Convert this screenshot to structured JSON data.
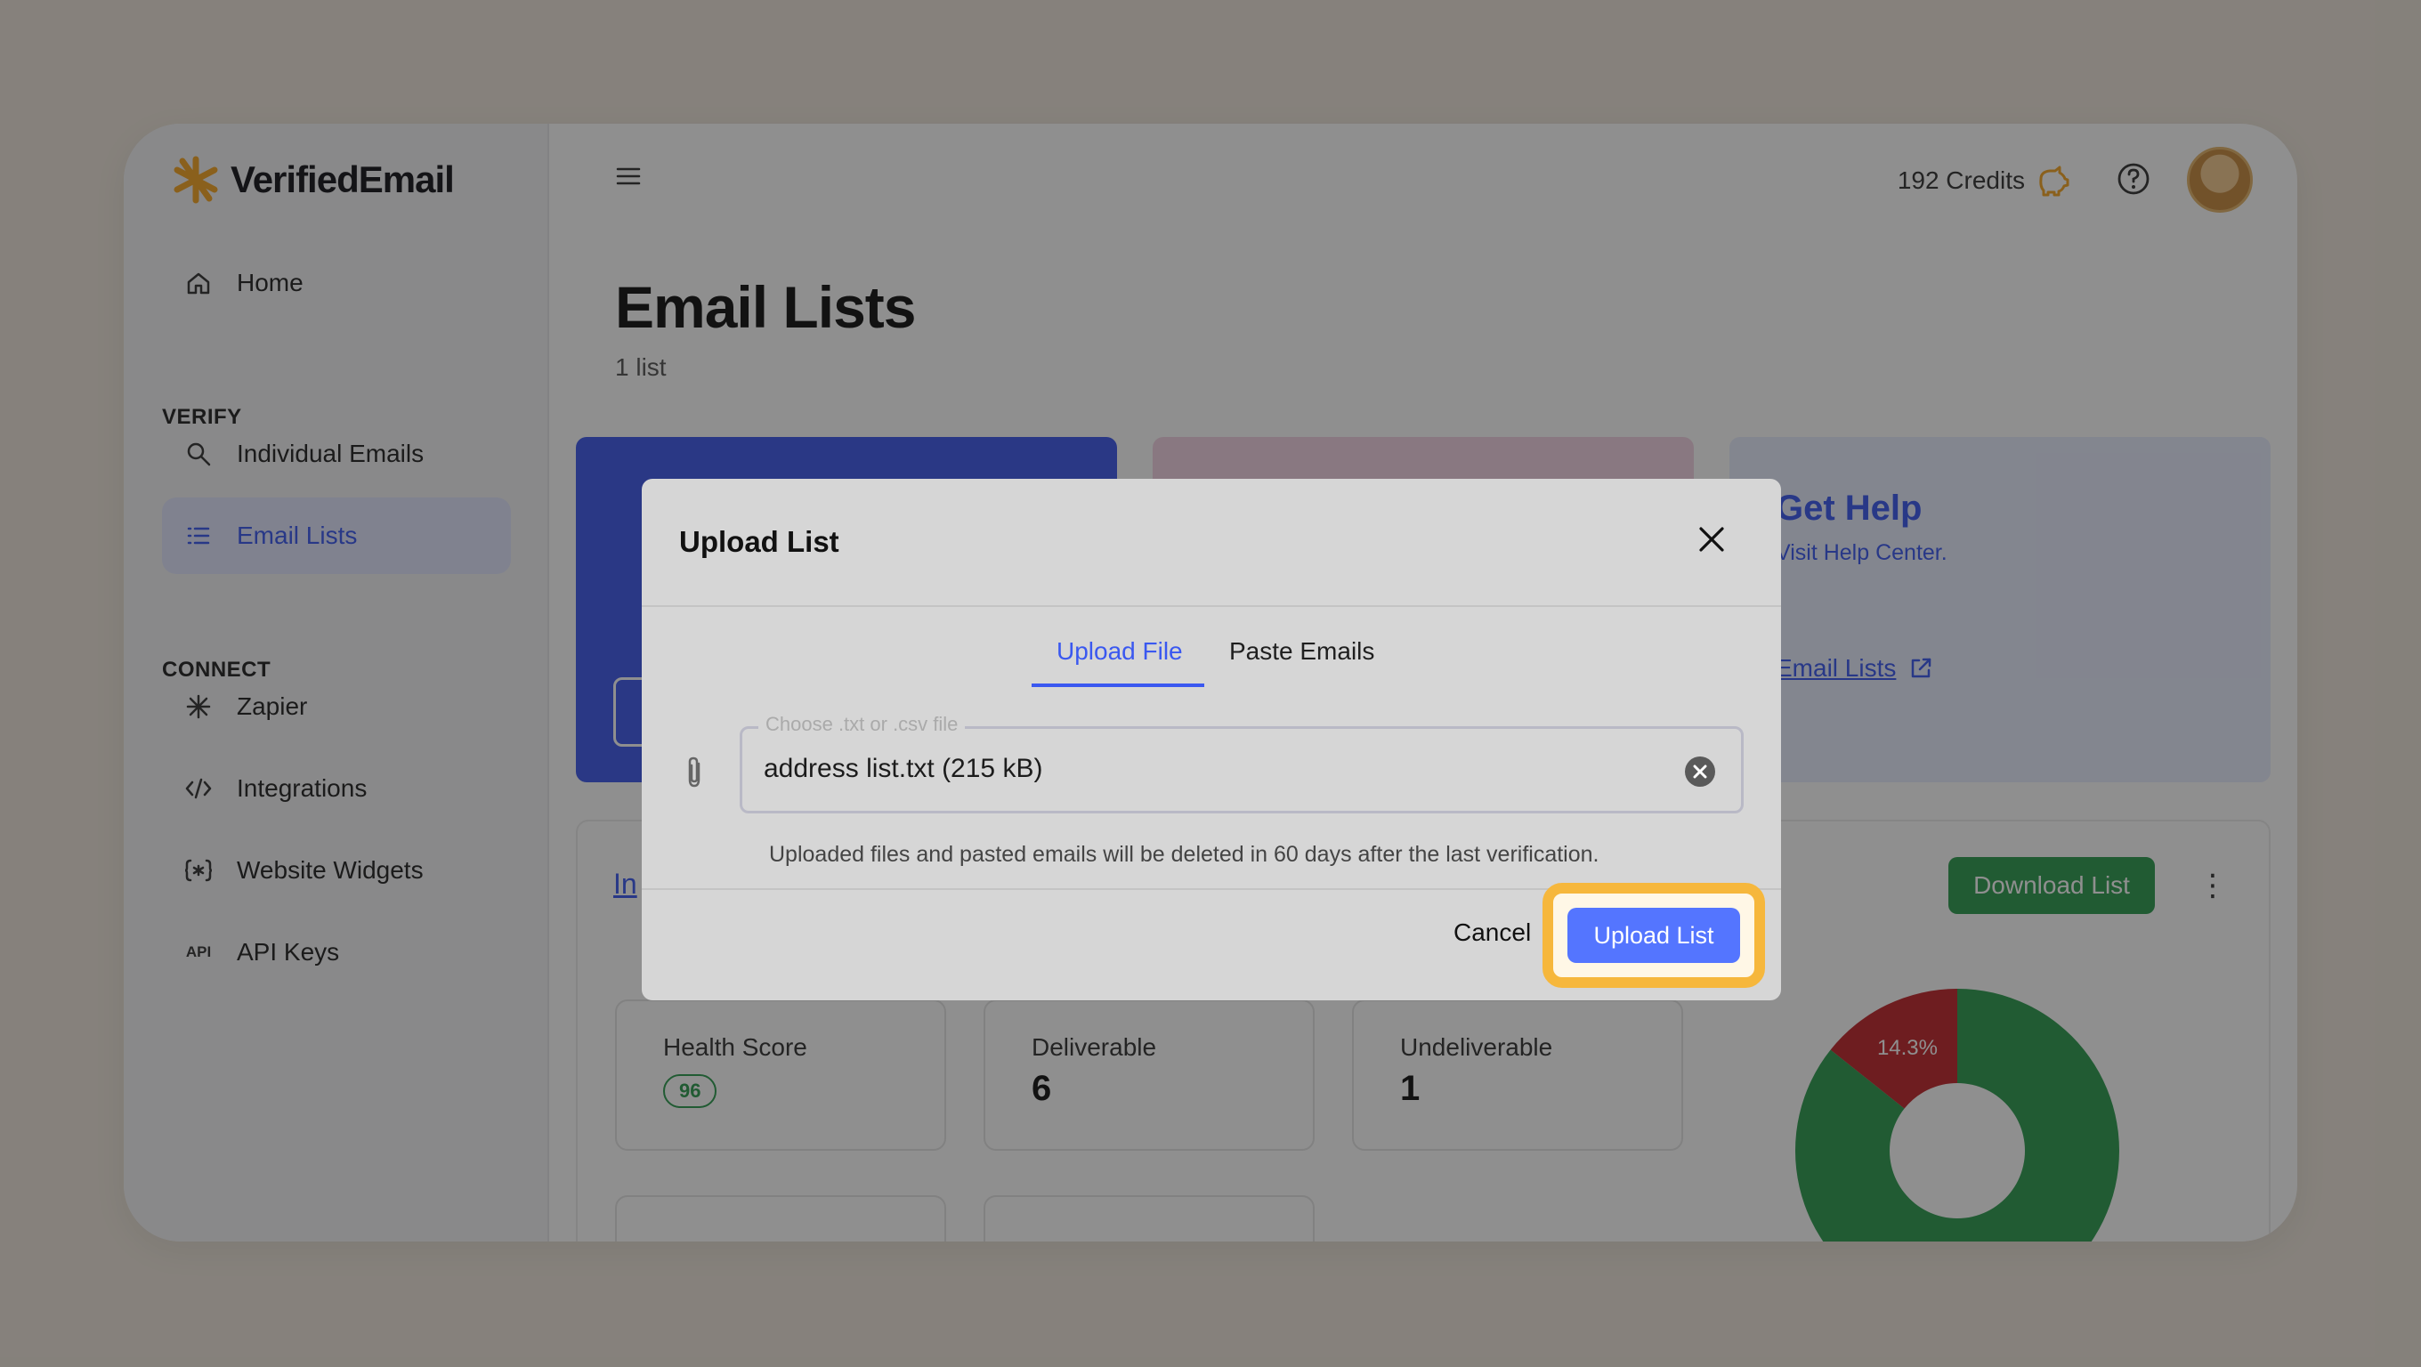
{
  "app": {
    "brand": "VerifiedEmail",
    "brand_color": "#f5a623",
    "accent_color": "#3a58f0"
  },
  "sidebar": {
    "home_label": "Home",
    "verify_section": "VERIFY",
    "verify_items": [
      {
        "label": "Individual Emails",
        "icon": "search-icon"
      },
      {
        "label": "Email Lists",
        "icon": "list-icon",
        "active": true
      }
    ],
    "connect_section": "CONNECT",
    "connect_items": [
      {
        "label": "Zapier",
        "icon": "zapier-icon"
      },
      {
        "label": "Integrations",
        "icon": "code-icon"
      },
      {
        "label": "Website Widgets",
        "icon": "widget-icon"
      },
      {
        "label": "API Keys",
        "icon": "api-icon"
      }
    ]
  },
  "header": {
    "credits": "192 Credits",
    "credits_icon": "piggy-bank-icon",
    "help_icon": "help-circle-icon"
  },
  "page": {
    "title": "Email Lists",
    "subtitle": "1 list"
  },
  "cards": {
    "help_title": "Get Help",
    "help_subtitle": "Visit Help Center.",
    "help_link": "Email Lists"
  },
  "panel": {
    "link_text": "In",
    "download_label": "Download List",
    "stats": [
      {
        "label": "Health Score",
        "value": "96"
      },
      {
        "label": "Deliverable",
        "value": "6"
      },
      {
        "label": "Undeliverable",
        "value": "1"
      }
    ],
    "donut": {
      "segments": [
        {
          "label": "14.3%",
          "value": 14.3,
          "color": "#c0262b"
        },
        {
          "value": 85.7,
          "color": "#2d9b4f"
        }
      ]
    }
  },
  "modal": {
    "title": "Upload List",
    "tabs": [
      {
        "label": "Upload File",
        "active": true
      },
      {
        "label": "Paste Emails",
        "active": false
      }
    ],
    "file_legend": "Choose .txt or .csv file",
    "file_value": "address list.txt (215 kB)",
    "notice": "Uploaded files and pasted emails will be deleted in 60 days after the last verification.",
    "cancel_label": "Cancel",
    "upload_label": "Upload List"
  }
}
